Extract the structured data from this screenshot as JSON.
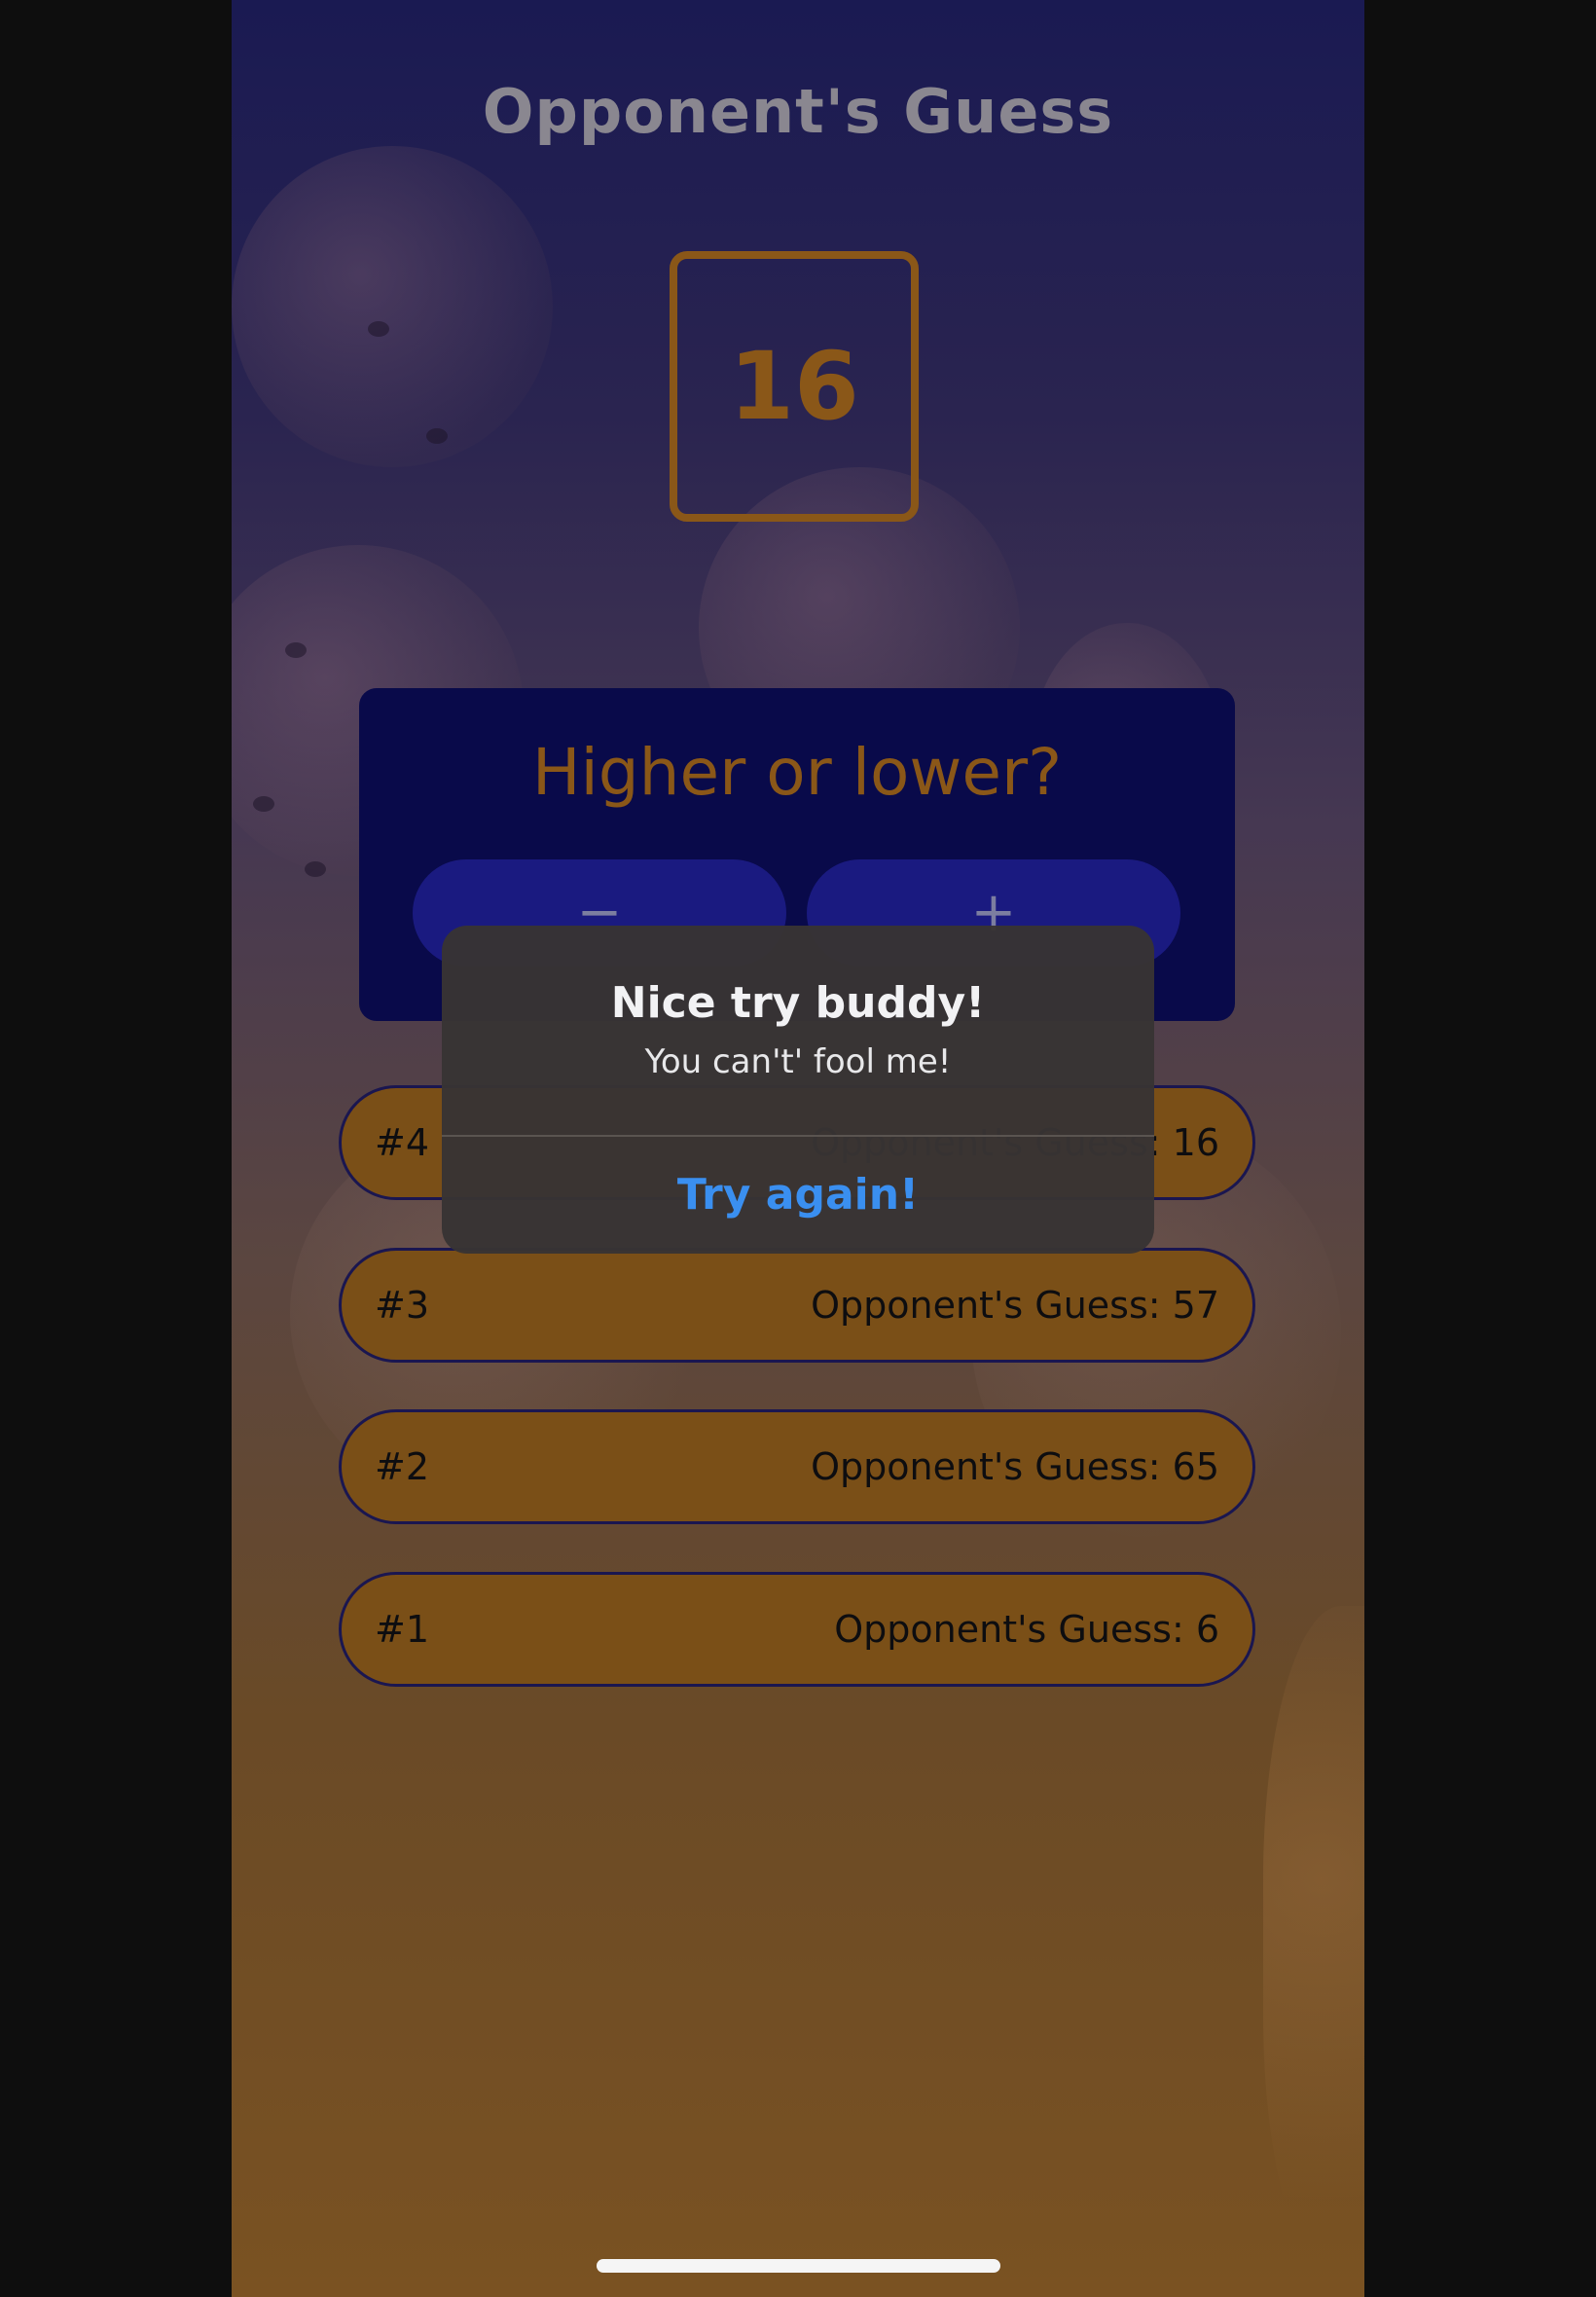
{
  "screen": {
    "title": "Opponent's Guess",
    "current_guess": "16"
  },
  "control_card": {
    "prompt": "Higher or lower?",
    "lower_button_label": "−",
    "higher_button_label": "+"
  },
  "guess_log": [
    {
      "round": "#4",
      "text": "Opponent's Guess: 16"
    },
    {
      "round": "#3",
      "text": "Opponent's Guess: 57"
    },
    {
      "round": "#2",
      "text": "Opponent's Guess: 65"
    },
    {
      "round": "#1",
      "text": "Opponent's Guess: 6"
    }
  ],
  "alert": {
    "title": "Nice try buddy!",
    "message": "You can't' fool me!",
    "button_label": "Try again!"
  },
  "colors": {
    "accent": "#8a5718",
    "card_background": "#090a4a",
    "button_background": "#1a1a80",
    "log_item_background": "#7a4f17",
    "alert_button_text": "#3a8ff0"
  }
}
